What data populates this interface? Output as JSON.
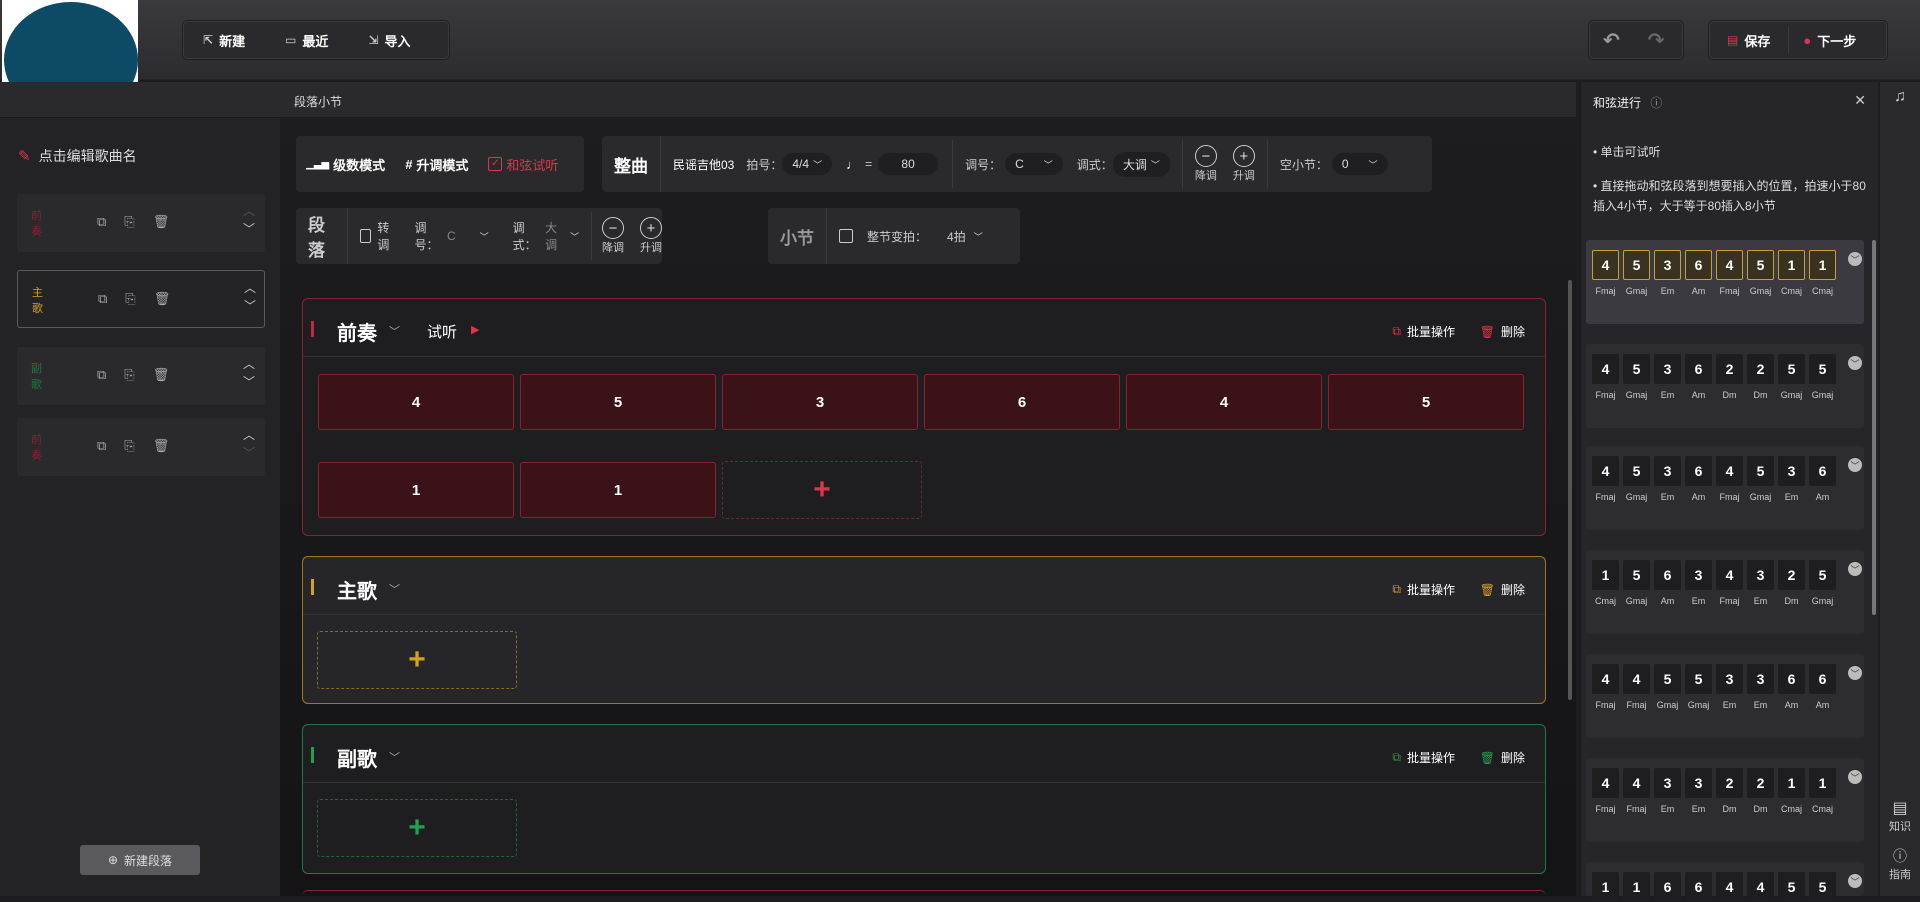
{
  "toolbar": {
    "new": "新建",
    "recent": "最近",
    "import": "导入",
    "save": "保存",
    "next": "下一步"
  },
  "subbar": {
    "label": "段落小节"
  },
  "left": {
    "edit_title": "点击编辑歌曲名",
    "sections": [
      {
        "tag": "前奏"
      },
      {
        "tag": "主歌"
      },
      {
        "tag": "副歌"
      },
      {
        "tag": "前奏"
      }
    ],
    "new_section": "新建段落"
  },
  "controls": {
    "mode_degree": "级数模式",
    "mode_sharp": "升调模式",
    "chord_listen": "和弦试听",
    "whole_title": "整曲",
    "style": "民谣吉他03",
    "beat_label": "拍号：",
    "beat_value": "4/4",
    "tempo_eq": "=",
    "tempo_value": "80",
    "key_label": "调号：",
    "key_value": "C",
    "mode_label": "调式：",
    "mode_value": "大调",
    "down": "降调",
    "up": "升调",
    "empty_label": "空小节：",
    "empty_value": "0",
    "para_title": "段落",
    "modulate": "转调",
    "para_key_label": "调号：",
    "para_key_value": "C",
    "para_mode_label": "调式：",
    "para_mode_value": "大调",
    "bar_title": "小节",
    "bar_change": "整节变拍：",
    "bar_value": "4拍"
  },
  "sections": [
    {
      "title": "前奏",
      "listen": "试听",
      "batch": "批量操作",
      "delete": "删除",
      "chords": [
        "4",
        "5",
        "3",
        "6",
        "4",
        "5",
        "1",
        "1"
      ],
      "color": "#c8283c"
    },
    {
      "title": "主歌",
      "batch": "批量操作",
      "delete": "删除",
      "chords": [],
      "color": "#d6a020"
    },
    {
      "title": "副歌",
      "batch": "批量操作",
      "delete": "删除",
      "chords": [],
      "color": "#1fa050"
    }
  ],
  "right": {
    "title": "和弦进行",
    "tip1": "单击可试听",
    "tip2": "直接拖动和弦段落到想要插入的位置，拍速小于80插入4小节，大于等于80插入8小节",
    "progressions": [
      {
        "nums": [
          "4",
          "5",
          "3",
          "6",
          "4",
          "5",
          "1",
          "1"
        ],
        "names": [
          "Fmaj",
          "Gmaj",
          "Em",
          "Am",
          "Fmaj",
          "Gmaj",
          "Cmaj",
          "Cmaj"
        ]
      },
      {
        "nums": [
          "4",
          "5",
          "3",
          "6",
          "2",
          "2",
          "5",
          "5"
        ],
        "names": [
          "Fmaj",
          "Gmaj",
          "Em",
          "Am",
          "Dm",
          "Dm",
          "Gmaj",
          "Gmaj"
        ]
      },
      {
        "nums": [
          "4",
          "5",
          "3",
          "6",
          "4",
          "5",
          "3",
          "6"
        ],
        "names": [
          "Fmaj",
          "Gmaj",
          "Em",
          "Am",
          "Fmaj",
          "Gmaj",
          "Em",
          "Am"
        ]
      },
      {
        "nums": [
          "1",
          "5",
          "6",
          "3",
          "4",
          "3",
          "2",
          "5"
        ],
        "names": [
          "Cmaj",
          "Gmaj",
          "Am",
          "Em",
          "Fmaj",
          "Em",
          "Dm",
          "Gmaj"
        ]
      },
      {
        "nums": [
          "4",
          "4",
          "5",
          "5",
          "3",
          "3",
          "6",
          "6"
        ],
        "names": [
          "Fmaj",
          "Fmaj",
          "Gmaj",
          "Gmaj",
          "Em",
          "Em",
          "Am",
          "Am"
        ]
      },
      {
        "nums": [
          "4",
          "4",
          "3",
          "3",
          "2",
          "2",
          "1",
          "1"
        ],
        "names": [
          "Fmaj",
          "Fmaj",
          "Em",
          "Em",
          "Dm",
          "Dm",
          "Cmaj",
          "Cmaj"
        ]
      },
      {
        "nums": [
          "1",
          "1",
          "6",
          "6",
          "4",
          "4",
          "5",
          "5"
        ],
        "names": []
      }
    ]
  },
  "rail": {
    "knowledge": "知识",
    "guide": "指南"
  }
}
